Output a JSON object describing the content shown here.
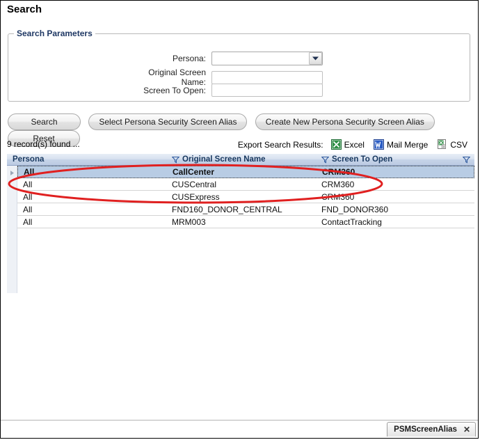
{
  "page_title": "Search",
  "fieldset": {
    "legend": "Search Parameters",
    "fields": [
      {
        "label": "Persona:",
        "value": "",
        "type": "combobox",
        "icon": "chevron-down-icon"
      },
      {
        "label": "Original Screen Name:",
        "value": "",
        "type": "text"
      },
      {
        "label": "Screen To Open:",
        "value": "",
        "type": "text"
      }
    ]
  },
  "buttons": [
    {
      "label": "Search",
      "name": "search-button"
    },
    {
      "label": "Select Persona Security Screen Alias",
      "name": "select-persona-security-screen-alias-button"
    },
    {
      "label": "Create New Persona Security Screen Alias",
      "name": "create-new-persona-security-screen-alias-button"
    },
    {
      "label": "Reset",
      "name": "reset-button"
    }
  ],
  "results": {
    "record_count_text": "9 record(s) found ...",
    "export_label": "Export Search Results:",
    "export_options": [
      {
        "label": "Excel",
        "icon": "excel-icon"
      },
      {
        "label": "Mail Merge",
        "icon": "word-icon"
      },
      {
        "label": "CSV",
        "icon": "csv-icon"
      }
    ]
  },
  "grid": {
    "columns": [
      {
        "header": "Persona",
        "filter_icon": "filter-icon",
        "filter_leading": false
      },
      {
        "header": "Original Screen Name",
        "filter_icon": "filter-icon",
        "filter_leading": true
      },
      {
        "header": "Screen To Open",
        "filter_icon": "filter-icon",
        "filter_leading": true
      }
    ],
    "trailing_filter_icon": "filter-icon",
    "row_indicator_icon": "row-selector-arrow-icon",
    "rows": [
      {
        "persona": "All",
        "original_screen_name": "CallCenter",
        "screen_to_open": "CRM360",
        "selected": true
      },
      {
        "persona": "All",
        "original_screen_name": "CUSCentral",
        "screen_to_open": "CRM360",
        "selected": false
      },
      {
        "persona": "All",
        "original_screen_name": "CUSExpress",
        "screen_to_open": "CRM360",
        "selected": false
      },
      {
        "persona": "All",
        "original_screen_name": "FND160_DONOR_CENTRAL",
        "screen_to_open": "FND_DONOR360",
        "selected": false
      },
      {
        "persona": "All",
        "original_screen_name": "MRM003",
        "screen_to_open": "ContactTracking",
        "selected": false
      }
    ]
  },
  "annotation": {
    "shape": "ellipse",
    "color": "#e02020",
    "name": "red-highlight-ellipse"
  },
  "statusbar": {
    "tab_label": "PSMScreenAlias",
    "tab_close_glyph": "✕"
  },
  "colors": {
    "header_text": "#17375e",
    "selection": "#b8cce4",
    "annotation_red": "#e02020",
    "legend_text": "#1f3864"
  }
}
